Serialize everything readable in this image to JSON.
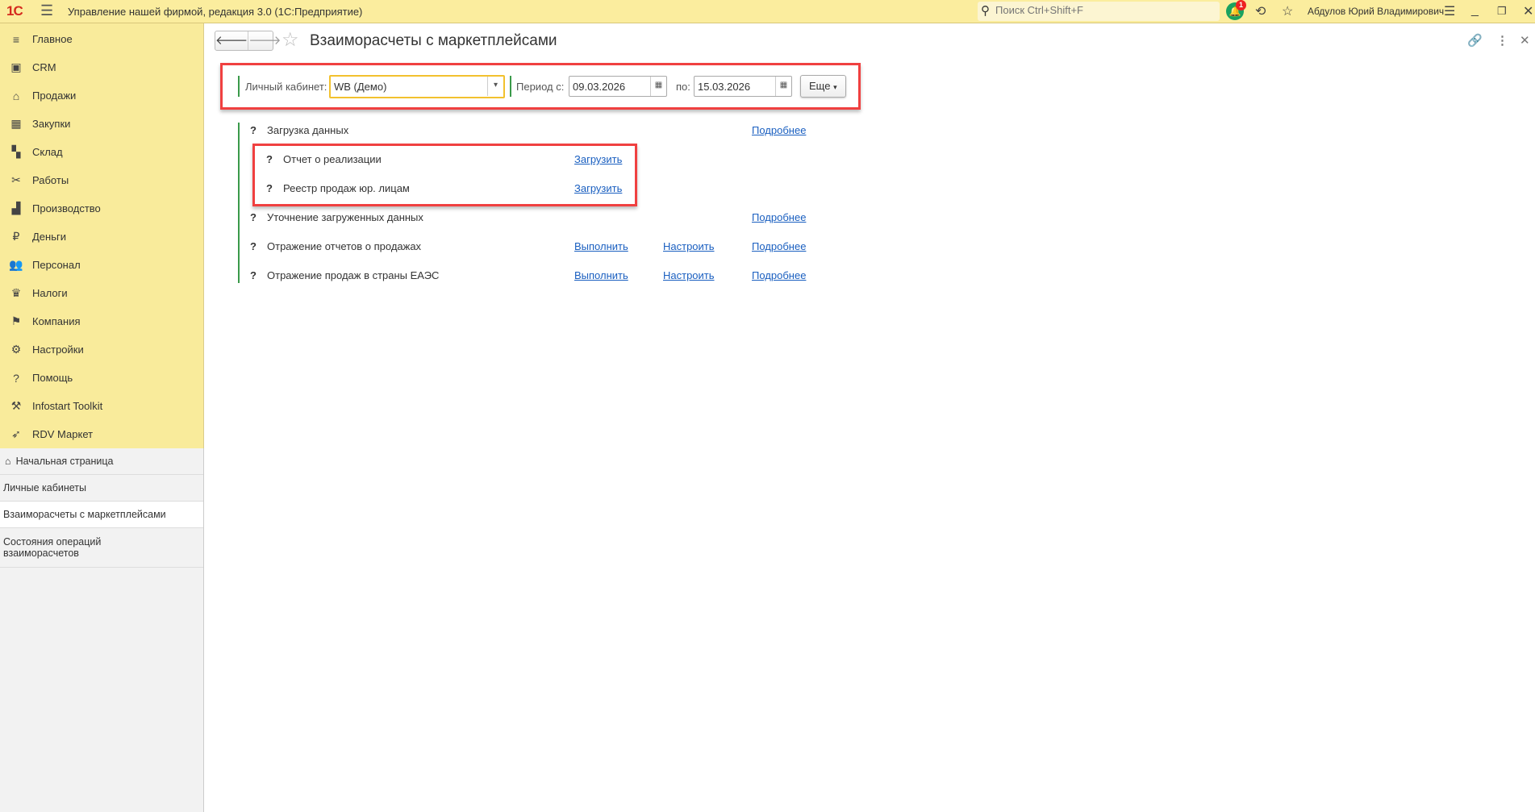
{
  "titlebar": {
    "logo": "1С",
    "title": "Управление нашей фирмой, редакция 3.0  (1С:Предприятие)",
    "search_placeholder": "Поиск Ctrl+Shift+F",
    "notifications": "1",
    "user": "Абдулов Юрий Владимирович"
  },
  "sidebar": {
    "items": [
      {
        "label": "Главное",
        "icon": "≡"
      },
      {
        "label": "CRM",
        "icon": "▣"
      },
      {
        "label": "Продажи",
        "icon": "⌂"
      },
      {
        "label": "Закупки",
        "icon": "▦"
      },
      {
        "label": "Склад",
        "icon": "▚"
      },
      {
        "label": "Работы",
        "icon": "✂"
      },
      {
        "label": "Производство",
        "icon": "▟"
      },
      {
        "label": "Деньги",
        "icon": "₽"
      },
      {
        "label": "Персонал",
        "icon": "👥"
      },
      {
        "label": "Налоги",
        "icon": "♛"
      },
      {
        "label": "Компания",
        "icon": "⚑"
      },
      {
        "label": "Настройки",
        "icon": "⚙"
      },
      {
        "label": "Помощь",
        "icon": "?"
      },
      {
        "label": "Infostart Toolkit",
        "icon": "⚒"
      },
      {
        "label": "RDV Маркет",
        "icon": "➶"
      }
    ]
  },
  "opened": {
    "home": "Начальная страница",
    "items": [
      "Личные кабинеты",
      "Взаиморасчеты с маркетплейсами",
      "Состояния операций взаиморасчетов"
    ]
  },
  "page": {
    "title": "Взаиморасчеты с маркетплейсами"
  },
  "filters": {
    "cabinet_label": "Личный кабинет:",
    "cabinet_value": "WB (Демо)",
    "period_label": "Период с:",
    "date_from": "09.03.2026",
    "to_label": "по:",
    "date_to": "15.03.2026",
    "more": "Еще"
  },
  "tasks": {
    "load": {
      "q": "?",
      "label": "Загрузка данных",
      "more": "Подробнее"
    },
    "sales_report": {
      "q": "?",
      "label": "Отчет о реализации",
      "action": "Загрузить"
    },
    "registry": {
      "q": "?",
      "label": "Реестр продаж юр. лицам",
      "action": "Загрузить"
    },
    "refine": {
      "q": "?",
      "label": "Уточнение загруженных данных",
      "more": "Подробнее"
    },
    "reports": {
      "q": "?",
      "label": "Отражение отчетов о продажах",
      "run": "Выполнить",
      "setup": "Настроить",
      "more": "Подробнее"
    },
    "eaeu": {
      "q": "?",
      "label": "Отражение продаж в страны ЕАЭС",
      "run": "Выполнить",
      "setup": "Настроить",
      "more": "Подробнее"
    }
  }
}
